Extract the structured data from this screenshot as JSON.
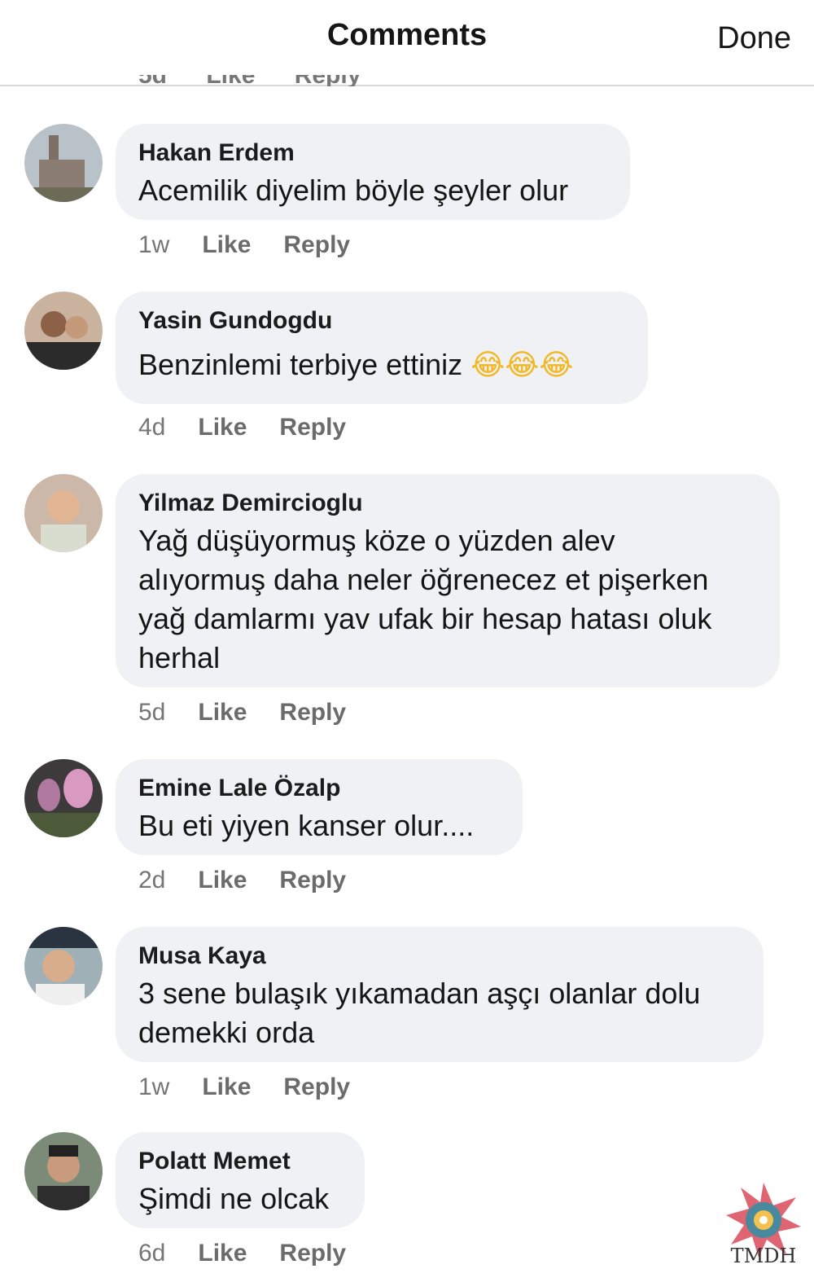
{
  "header": {
    "title": "Comments",
    "done_label": "Done"
  },
  "cutoff_meta": "5d Like Reply",
  "actions": {
    "like": "Like",
    "reply": "Reply"
  },
  "comments": [
    {
      "author": "Hakan Erdem",
      "text": "Acemilik diyelim böyle şeyler olur",
      "time": "1w"
    },
    {
      "author": "Yasin Gundogdu",
      "text": "Benzinlemi terbiye ettiniz",
      "time": "4d",
      "emoji": "😂😂😂"
    },
    {
      "author": "Yilmaz Demircioglu",
      "text_lines": [
        "Yağ düşüyormuş köze o yüzden alev",
        "alıyormuş daha neler öğrenecez et pişerken",
        "yağ damlarmı yav ufak bir hesap hatası oluk",
        "herhal"
      ],
      "time": "5d"
    },
    {
      "author": "Emine Lale Özalp",
      "text": "Bu eti yiyen kanser olur....",
      "time": "2d"
    },
    {
      "author": "Musa Kaya",
      "text_lines": [
        "3 sene bulaşık yıkamadan aşçı olanlar dolu",
        "demekki orda"
      ],
      "time": "1w"
    },
    {
      "author": "Polatt Memet",
      "text": "Şimdi ne olcak",
      "time": "6d"
    }
  ],
  "watermark": {
    "text": "TMDH"
  }
}
